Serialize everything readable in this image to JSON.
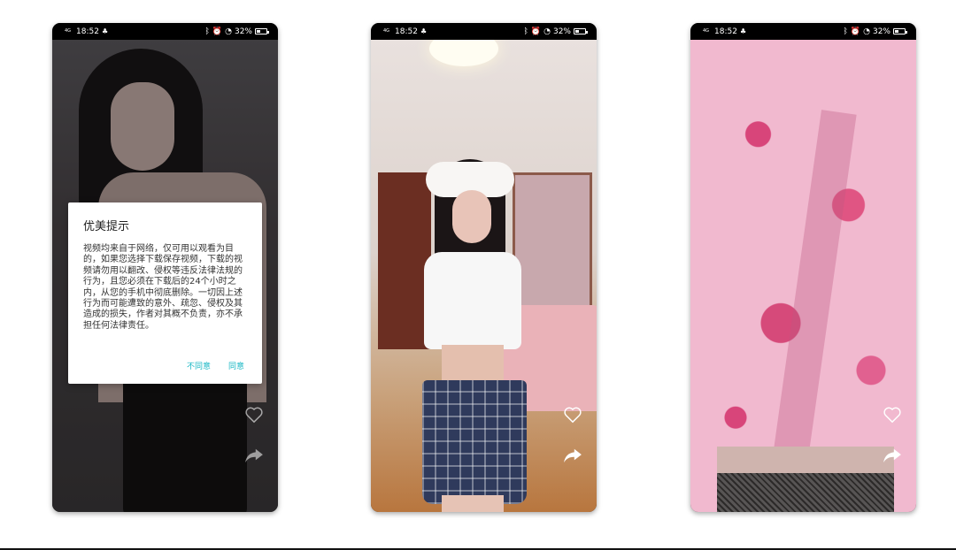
{
  "status_bar": {
    "network": "4G",
    "time": "18:52",
    "battery": "32%"
  },
  "dialog": {
    "title": "优美提示",
    "message": "视频均来自于网络，仅可用以观看为目的，如果您选择下载保存视频，下载的视频请勿用以翻改、侵权等违反法律法规的行为，且您必须在下载后的24个小时之内，从您的手机中彻底删除。一切因上述行为而可能遭致的意外、疏忽、侵权及其造成的损失，作者对其概不负责，亦不承担任何法律责任。",
    "disagree_label": "不同意",
    "agree_label": "同意"
  },
  "icons": {
    "like": "heart-outline-icon",
    "share": "share-arrow-icon",
    "notification": "bell-icon",
    "bluetooth": "bluetooth-icon",
    "alarm": "alarm-icon",
    "wifi": "wifi-icon",
    "battery": "battery-icon"
  },
  "colors": {
    "dialog_button": "#18b7c4",
    "status_bar_bg": "#000000"
  }
}
